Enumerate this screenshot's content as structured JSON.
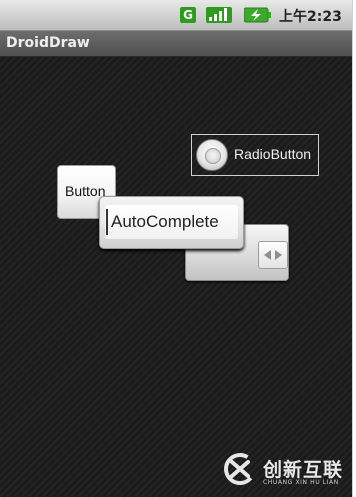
{
  "status_bar": {
    "icons": [
      "g-icon",
      "signal-icon",
      "battery-charging-icon"
    ],
    "g_icon_text": "G",
    "time": "上午2:23",
    "colors": {
      "g_icon": "#2e9b1e",
      "battery": "#3da92c"
    }
  },
  "app": {
    "title": "DroidDraw"
  },
  "widgets": {
    "radio_button_label": "RadioButton",
    "button_label": "Button",
    "autocomplete_text": "AutoComplete",
    "spinner_icon": "spinner-arrows-icon"
  },
  "watermark": {
    "logo_icon": "chuangxin-logo-icon",
    "cn_text": "创新互联",
    "en_text": "CHUANG XIN HU LIAN"
  }
}
